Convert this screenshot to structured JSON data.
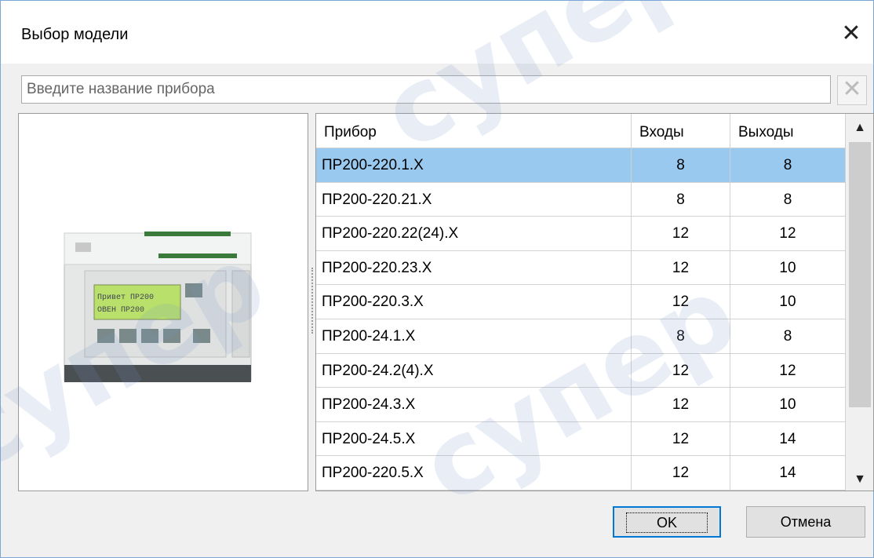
{
  "window": {
    "title": "Выбор модели",
    "close_icon": "close-icon"
  },
  "search": {
    "placeholder": "Введите название прибора",
    "value": "",
    "clear_icon": "clear-x-icon"
  },
  "preview": {
    "image": "device-pr200-photo",
    "display_line1": "Привет ПР200",
    "display_line2": "ОВЕН ПР200"
  },
  "table": {
    "columns": [
      "Прибор",
      "Входы",
      "Выходы"
    ],
    "selected_index": 0,
    "rows": [
      {
        "device": "ПР200-220.1.X",
        "inputs": "8",
        "outputs": "8"
      },
      {
        "device": "ПР200-220.21.X",
        "inputs": "8",
        "outputs": "8"
      },
      {
        "device": "ПР200-220.22(24).X",
        "inputs": "12",
        "outputs": "12"
      },
      {
        "device": "ПР200-220.23.X",
        "inputs": "12",
        "outputs": "10"
      },
      {
        "device": "ПР200-220.3.X",
        "inputs": "12",
        "outputs": "10"
      },
      {
        "device": "ПР200-24.1.X",
        "inputs": "8",
        "outputs": "8"
      },
      {
        "device": "ПР200-24.2(4).X",
        "inputs": "12",
        "outputs": "12"
      },
      {
        "device": "ПР200-24.3.X",
        "inputs": "12",
        "outputs": "10"
      },
      {
        "device": "ПР200-24.5.X",
        "inputs": "12",
        "outputs": "14"
      },
      {
        "device": "ПР200-220.5.X",
        "inputs": "12",
        "outputs": "14"
      }
    ]
  },
  "buttons": {
    "ok_label": "OK",
    "cancel_label": "Отмена"
  },
  "watermark": {
    "text": "супер"
  },
  "colors": {
    "selection": "#99c9ef",
    "accent": "#0078d7",
    "lcd": "#b8e06a"
  }
}
